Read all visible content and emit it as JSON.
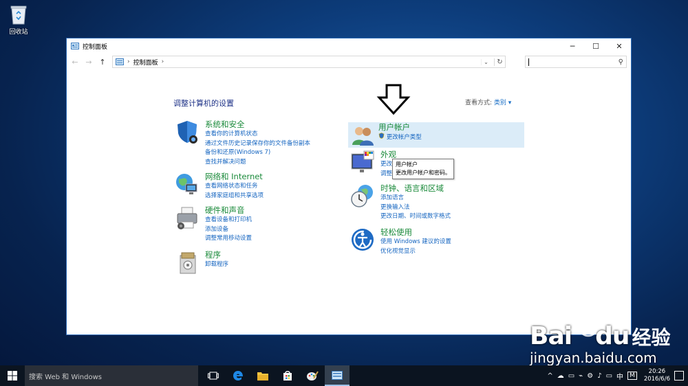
{
  "desktop": {
    "recycle_bin_label": "回收站"
  },
  "window": {
    "title": "控制面板",
    "icon": "control-panel-icon",
    "buttons": {
      "minimize": "─",
      "maximize": "☐",
      "close": "✕"
    }
  },
  "addressbar": {
    "breadcrumb": "控制面板",
    "search_value": ""
  },
  "content": {
    "heading": "调整计算机的设置",
    "view_by_label": "查看方式:",
    "view_by_value": "类别 ▾",
    "categories": [
      {
        "title": "系统和安全",
        "icon": "shield-icon",
        "links": [
          "查看你的计算机状态",
          "通过文件历史记录保存你的文件备份副本",
          "备份和还原(Windows 7)",
          "查找并解决问题"
        ]
      },
      {
        "title": "网络和 Internet",
        "icon": "globe-network-icon",
        "links": [
          "查看网络状态和任务",
          "选择家庭组和共享选项"
        ]
      },
      {
        "title": "硬件和声音",
        "icon": "printer-icon",
        "links": [
          "查看设备和打印机",
          "添加设备",
          "调整常用移动设置"
        ]
      },
      {
        "title": "程序",
        "icon": "programs-icon",
        "links": [
          "卸载程序"
        ]
      },
      {
        "title": "用户帐户",
        "icon": "users-icon",
        "links": [
          "更改帐户类型"
        ]
      },
      {
        "title": "外观",
        "icon": "appearance-icon",
        "links": [
          "更改主题",
          "调整屏幕分辨率"
        ]
      },
      {
        "title": "时钟、语言和区域",
        "icon": "clock-globe-icon",
        "links": [
          "添加语言",
          "更换输入法",
          "更改日期、时间或数字格式"
        ]
      },
      {
        "title": "轻松使用",
        "icon": "ease-of-access-icon",
        "links": [
          "使用 Windows 建议的设置",
          "优化视觉显示"
        ]
      }
    ],
    "tooltip": {
      "line1": "用户帐户",
      "line2": "更改用户帐户和密码。"
    }
  },
  "watermark": {
    "brand": "Bai",
    "brand2": "经验",
    "url": "jingyan.baidu.com"
  },
  "taskbar": {
    "search_placeholder": "搜索 Web 和 Windows",
    "ime": "中",
    "ime_mode": "M",
    "time": "20:26",
    "date": "2016/6/6"
  }
}
